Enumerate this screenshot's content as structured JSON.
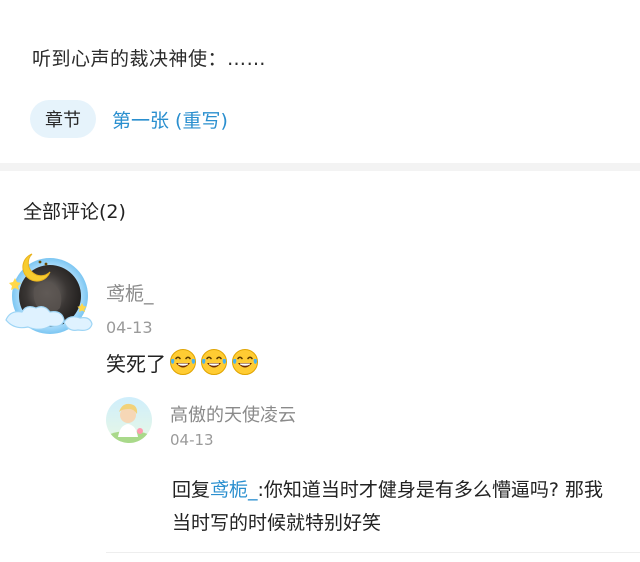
{
  "quote": {
    "text": "听到心声的裁决神使：……"
  },
  "tags": {
    "chip_label": "章节",
    "chapter_link": "第一张 (重写)"
  },
  "comments": {
    "heading": "全部评论(2)",
    "items": [
      {
        "username": "鸢栀_",
        "date": "04-13",
        "body": "笑死了",
        "emojis": [
          "laughing-tears-emoji",
          "laughing-tears-emoji",
          "laughing-tears-emoji"
        ],
        "replies": [
          {
            "username": "高傲的天使凌云",
            "date": "04-13",
            "prefix": "回复",
            "mention": "鸢栀_",
            "text": ":你知道当时才健身是有多么懵逼吗? 那我当时写的时候就特别好笑"
          }
        ]
      }
    ]
  },
  "colors": {
    "link": "#2a8fcf",
    "chip_bg": "#e6f3fb",
    "muted": "#8a8a8a"
  }
}
